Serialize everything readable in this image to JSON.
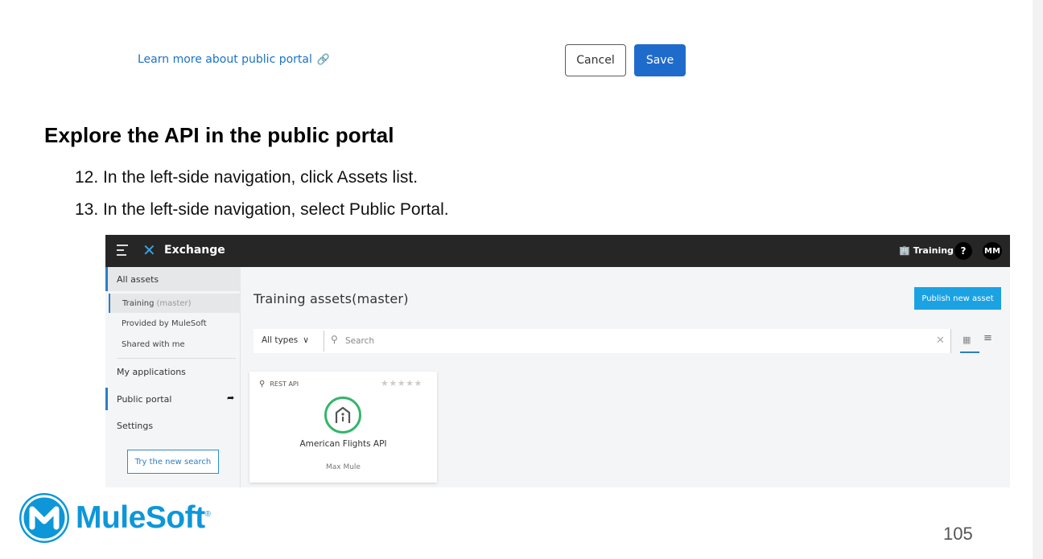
{
  "top_snippet": {
    "learn_link": "Learn more about public portal",
    "cancel_label": "Cancel",
    "save_label": "Save"
  },
  "section": {
    "heading": "Explore the API in the public portal",
    "steps": [
      "12. In the left-side navigation, click Assets list.",
      "13. In the left-side navigation, select Public Portal."
    ]
  },
  "exchange": {
    "app_title": "Exchange",
    "org_name": "Training",
    "help_label": "?",
    "user_initials": "MM",
    "sidebar": {
      "all_assets": "All assets",
      "training": "Training",
      "training_branch": "(master)",
      "provided": "Provided by MuleSoft",
      "shared": "Shared with me",
      "my_applications": "My applications",
      "public_portal": "Public portal",
      "settings": "Settings",
      "try_new_search": "Try the new search"
    },
    "main_title": "Training assets(master)",
    "publish_label": "Publish new asset",
    "type_filter": "All types",
    "search_placeholder": "Search",
    "asset": {
      "type": "REST API",
      "rating_stars": "★★★★★",
      "name": "American Flights API",
      "owner": "Max Mule"
    }
  },
  "footer": {
    "brand": "MuleSoft",
    "trademark": "®",
    "page_number": "105"
  },
  "colors": {
    "link": "#1a73c8",
    "save_button": "#1f6bcb",
    "exchange_topbar": "#262626",
    "publish_button": "#1ba2e3",
    "asset_logo_ring": "#35b56a",
    "mulesoft_blue": "#0d97d8"
  }
}
